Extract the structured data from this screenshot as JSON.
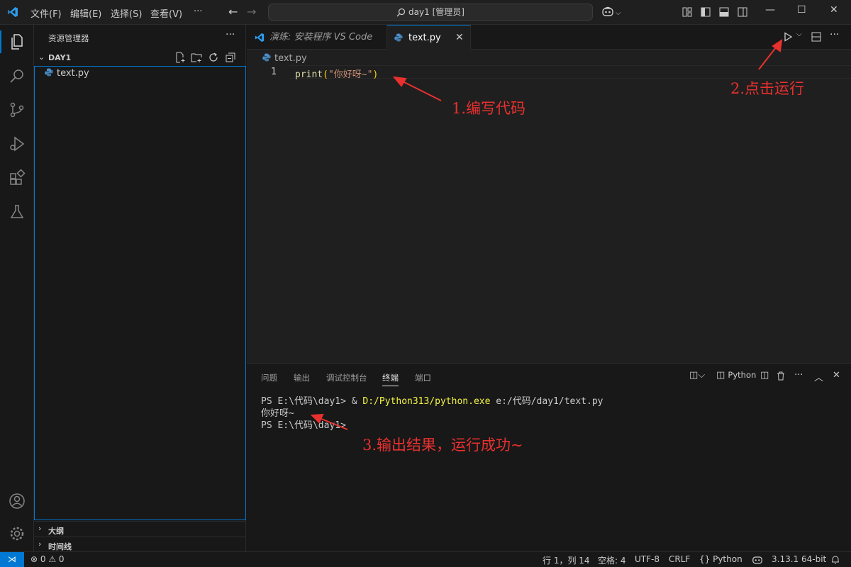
{
  "titlebar": {
    "menu": [
      "文件(F)",
      "编辑(E)",
      "选择(S)",
      "查看(V)",
      "···"
    ],
    "search_text": "day1 [管理员]",
    "copilot_label": "⌵"
  },
  "sidebar": {
    "title": "资源管理器",
    "more": "···",
    "folder": "DAY1",
    "files": [
      "text.py"
    ],
    "sections": [
      "大纲",
      "时间线"
    ]
  },
  "editor": {
    "tabs": [
      {
        "label": "演练: 安装程序 VS Code",
        "active": false
      },
      {
        "label": "text.py",
        "active": true
      }
    ],
    "breadcrumb": "text.py",
    "line_number": "1",
    "code": {
      "fn": "print",
      "open": "(",
      "str": "\"你好呀~\"",
      "close": ")"
    }
  },
  "panel": {
    "tabs": [
      "问题",
      "输出",
      "调试控制台",
      "终端",
      "端口"
    ],
    "active_tab": "终端",
    "terminal_profile": "Python",
    "terminal": {
      "line1_prompt": "PS E:\\代码\\day1> & ",
      "line1_exe": "D:/Python313/python.exe",
      "line1_arg": " e:/代码/day1/text.py",
      "line2": "你好呀~",
      "line3": "PS E:\\代码\\day1>"
    }
  },
  "statusbar": {
    "problems": "⊗ 0 ⚠ 0",
    "position": "行 1，列 14",
    "indent": "空格: 4",
    "encoding": "UTF-8",
    "eol": "CRLF",
    "language": "{} Python",
    "interpreter": "3.13.1 64-bit"
  },
  "annotations": {
    "step1": "1.编写代码",
    "step2": "2.点击运行",
    "step3": "3.输出结果，运行成功~"
  },
  "colors": {
    "accent": "#0078d4",
    "annotation": "#e8312f",
    "editor_bg": "#1f1f1f"
  }
}
